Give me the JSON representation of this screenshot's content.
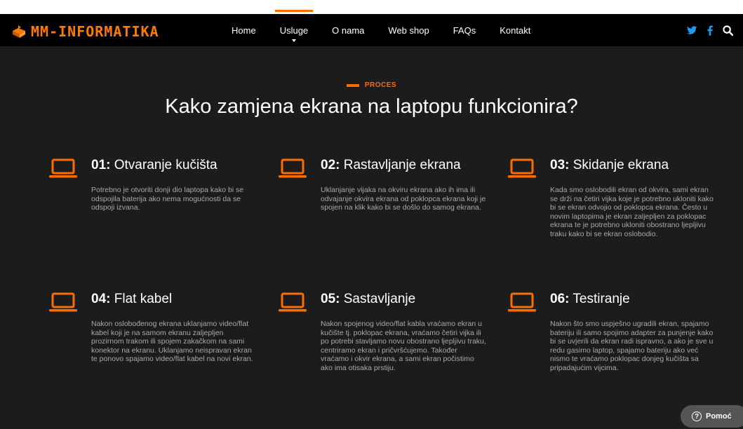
{
  "brand": {
    "name": "MM-INFORMATIKA",
    "accent": "#ff6d00"
  },
  "nav": {
    "items": [
      {
        "label": "Home"
      },
      {
        "label": "Usluge",
        "active": true,
        "has_dropdown": true
      },
      {
        "label": "O nama"
      },
      {
        "label": "Web shop"
      },
      {
        "label": "FAQs"
      },
      {
        "label": "Kontakt"
      }
    ],
    "icons": [
      "twitter-icon",
      "facebook-icon",
      "search-icon"
    ]
  },
  "section": {
    "tag": "PROCES",
    "title": "Kako zamjena ekrana na laptopu funkcionira?"
  },
  "steps": [
    {
      "number": "01:",
      "title": "Otvaranje  kučišta",
      "text": "Potrebno je otvoriti donji dio laptopa kako bi se odspojila baterija ako nema mogućnosti da se odspoji izvana.",
      "icon": "laptop-icon"
    },
    {
      "number": "02:",
      "title": "Rastavljanje ekrana",
      "text": "Uklanjanje vijaka na okviru ekrana ako ih ima ili odvajanje okvira ekrana od poklopca ekrana koji je spojen na klik kako bi se došlo do samog ekrana.",
      "icon": "laptop-icon"
    },
    {
      "number": "03:",
      "title": "Skidanje ekrana",
      "text": "Kada smo oslobodili ekran od okvira, sami ekran se drži na četiri vijka koje je potrebno ukloniti kako bi se ekran odvojio od poklopca ekrana. Često u novim laptopima je ekran zaljepljen za poklopac ekrana te je potrebno ukloniti obostrano ljepljivu traku kako bi se ekran oslobodio.",
      "icon": "laptop-icon"
    },
    {
      "number": "04:",
      "title": "Flat kabel",
      "text": "Nakon oslobođenog ekrana uklanjamo video/flat kabel koji je na samom ekranu zaljepljen prozirnom trakom ili spojem zakačkom na sami konektor na ekranu. Uklanjamo neispravan ekran te ponovo spajamo video/flat kabel na novi ekran.",
      "icon": "laptop-icon"
    },
    {
      "number": "05:",
      "title": "Sastavljanje",
      "text": "Nakon spojenog video/flat kabla vraćamo ekran u kučište tj. poklopac ekrana, vraćamo četiri vijka ili po potrebi stavljamo novu obostrano ljepljivu traku, centriramo ekran i pričvršćujemo. Također vraćamo i okvir ekrana, a sami ekran počistimo ako ima otisaka prstiju.",
      "icon": "laptop-icon"
    },
    {
      "number": "06:",
      "title": "Testiranje",
      "text": "Nakon što smo uspješno ugradili ekran, spajamo bateriju ili samo spojimo adapter za punjenje kako bi se uvjerili da ekran radi ispravno, a ako je sve u redu gasimo laptop, spajamo bateriju ako već nismo te vraćamo poklopac donjeg kučišta sa pripadajućim vijcima.",
      "icon": "laptop-icon"
    }
  ],
  "help": {
    "label": "Pomoć",
    "symbol": "?"
  }
}
